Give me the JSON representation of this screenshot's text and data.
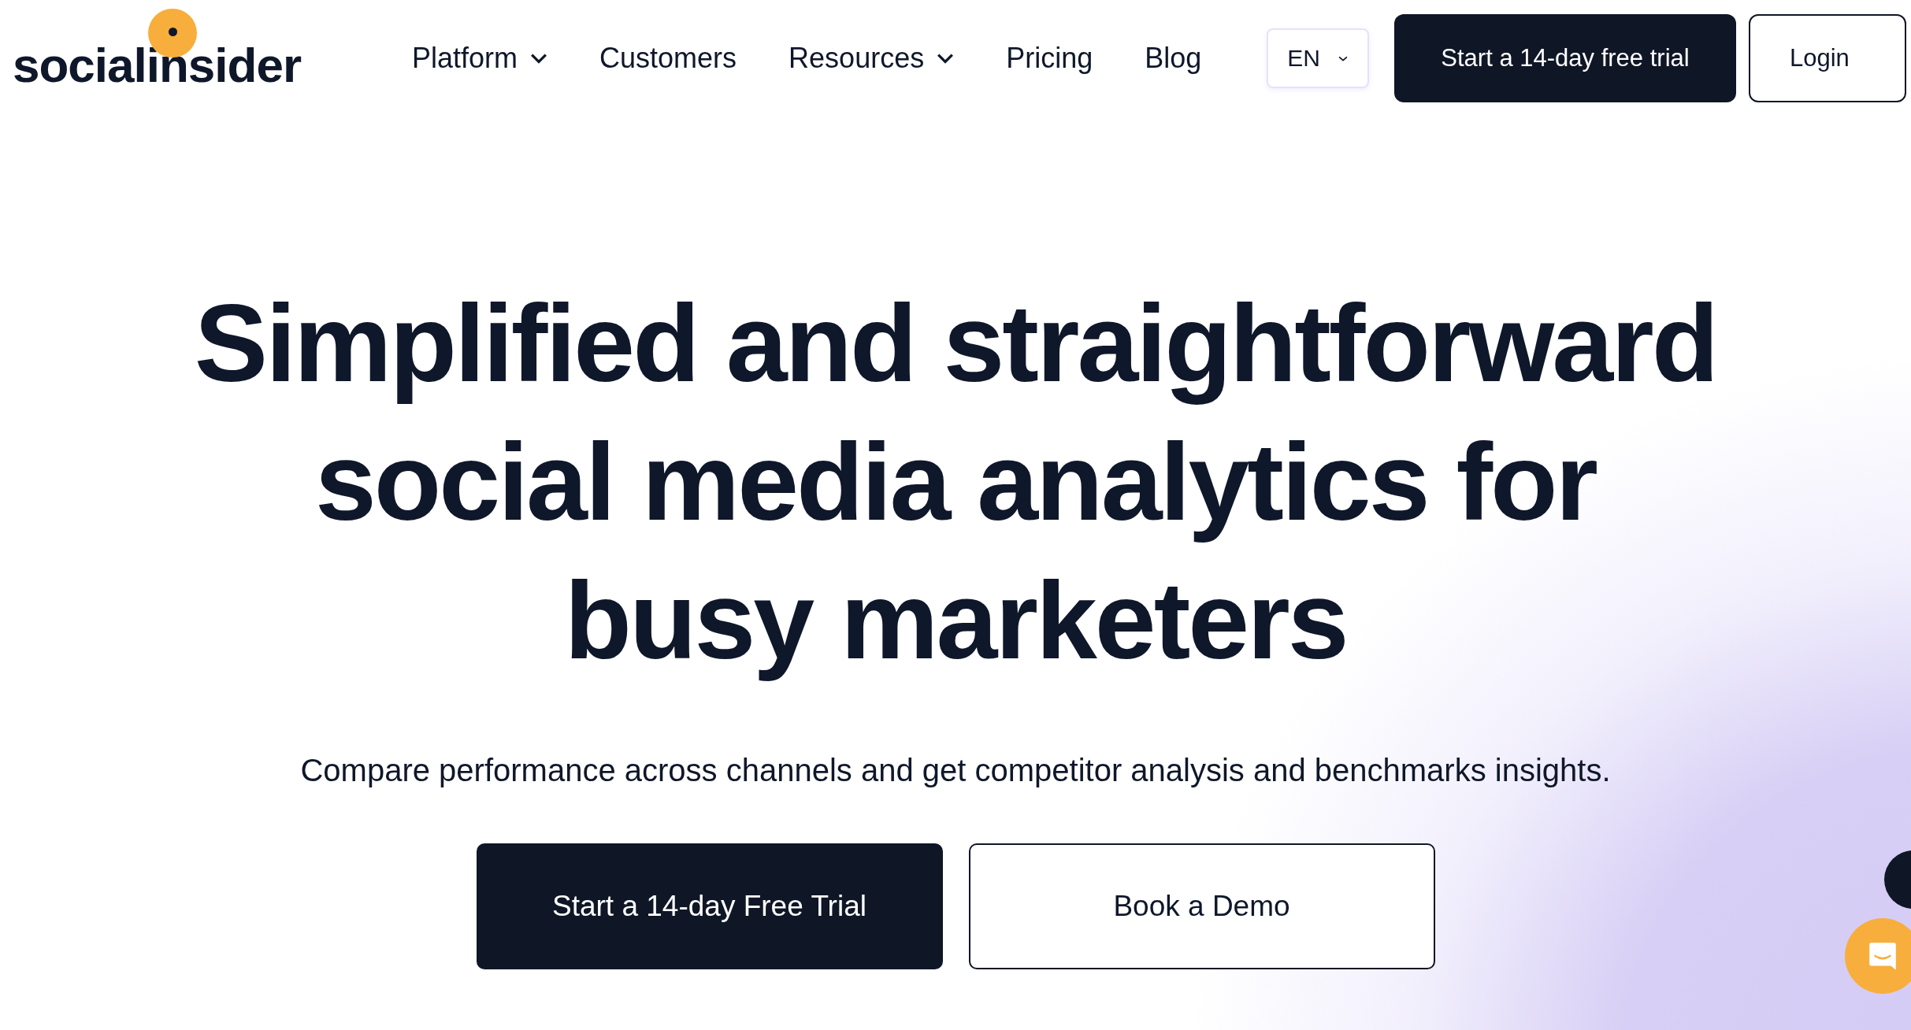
{
  "logo": {
    "text": "socialinsider"
  },
  "nav": [
    {
      "label": "Platform",
      "dropdown": true
    },
    {
      "label": "Customers",
      "dropdown": false
    },
    {
      "label": "Resources",
      "dropdown": true
    },
    {
      "label": "Pricing",
      "dropdown": false
    },
    {
      "label": "Blog",
      "dropdown": false
    }
  ],
  "language": "EN",
  "header_buttons": [
    {
      "label": "Start a 14-day free trial",
      "kind": "primary"
    },
    {
      "label": "Login",
      "kind": "outline"
    }
  ],
  "hero": {
    "title_lines": [
      "Simplified and straightforward",
      "social media analytics for",
      "busy marketers"
    ],
    "subtitle": "Compare performance across channels and get competitor analysis and benchmarks insights.",
    "buttons": [
      {
        "label": "Start a 14-day Free Trial",
        "kind": "primary"
      },
      {
        "label": "Book a Demo",
        "kind": "outline"
      }
    ]
  }
}
